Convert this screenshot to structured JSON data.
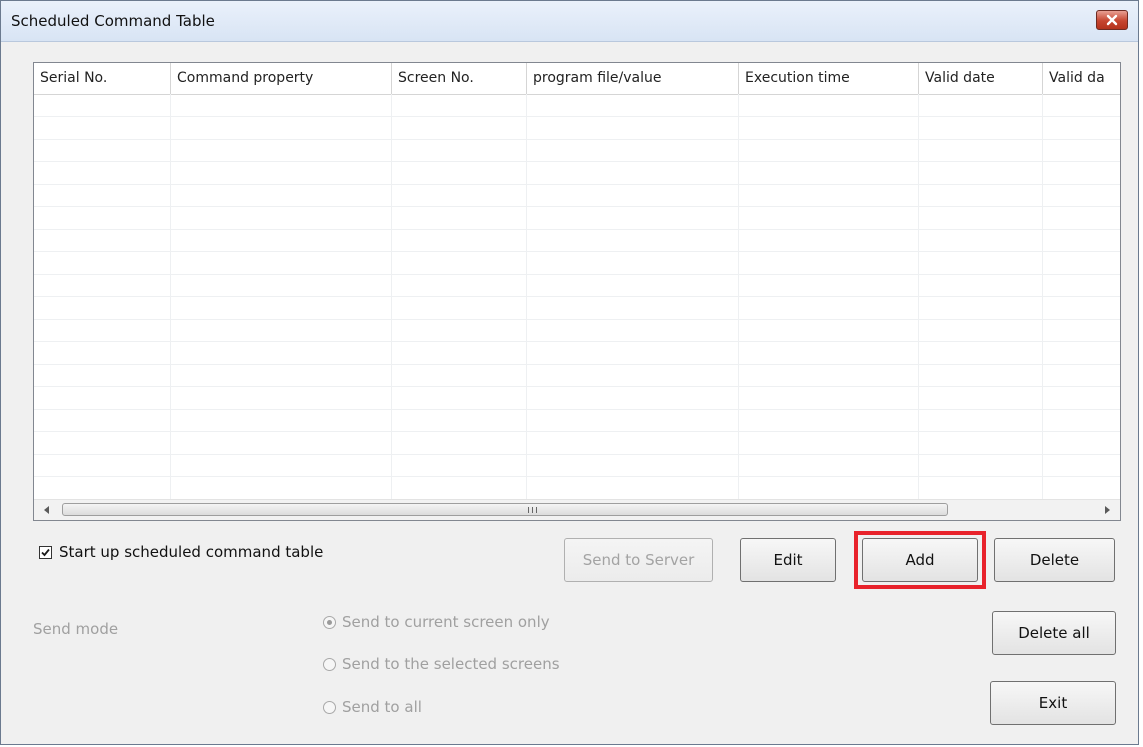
{
  "window": {
    "title": "Scheduled Command Table",
    "close_icon": "close-icon"
  },
  "table": {
    "columns": [
      "Serial No.",
      "Command property",
      "Screen No.",
      "program file/value",
      "Execution time",
      "Valid date",
      "Valid da"
    ],
    "rows": []
  },
  "scrollbar": {
    "left_icon": "arrow-left-icon",
    "right_icon": "arrow-right-icon",
    "grip": "III"
  },
  "startup": {
    "label": "Start up scheduled command table",
    "checked": true
  },
  "buttons": {
    "send_to_server": "Send to Server",
    "edit": "Edit",
    "add": "Add",
    "delete": "Delete",
    "delete_all": "Delete all",
    "exit": "Exit"
  },
  "send_mode": {
    "label": "Send mode",
    "options": [
      "Send to current screen only",
      "Send to the selected screens",
      "Send to all"
    ],
    "selected_index": 0,
    "enabled": false
  },
  "colors": {
    "highlight": "#e8222b",
    "close_button": "#c6452f"
  }
}
